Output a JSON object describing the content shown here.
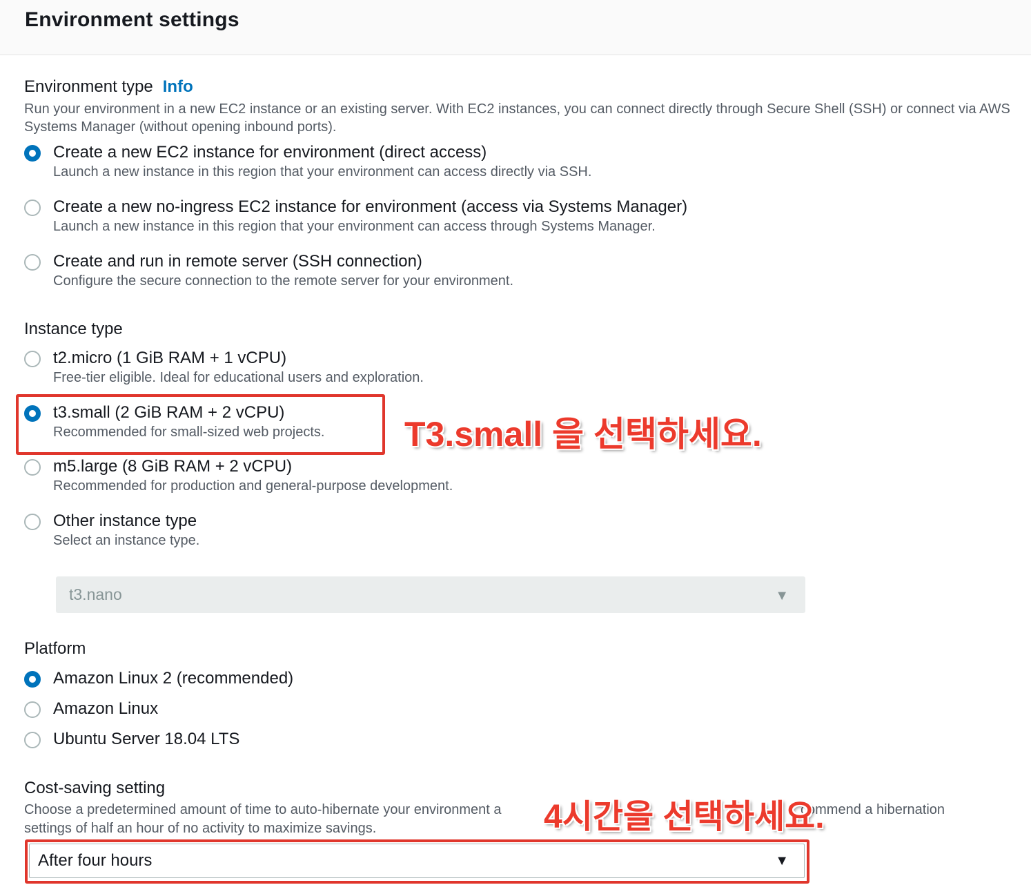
{
  "header": {
    "title": "Environment settings"
  },
  "environment_type": {
    "label": "Environment type",
    "info_link": "Info",
    "description": "Run your environment in a new EC2 instance or an existing server. With EC2 instances, you can connect directly through Secure Shell (SSH) or connect via AWS Systems Manager (without opening inbound ports).",
    "options": [
      {
        "label": "Create a new EC2 instance for environment (direct access)",
        "description": "Launch a new instance in this region that your environment can access directly via SSH.",
        "selected": true
      },
      {
        "label": "Create a new no-ingress EC2 instance for environment (access via Systems Manager)",
        "description": "Launch a new instance in this region that your environment can access through Systems Manager.",
        "selected": false
      },
      {
        "label": "Create and run in remote server (SSH connection)",
        "description": "Configure the secure connection to the remote server for your environment.",
        "selected": false
      }
    ]
  },
  "instance_type": {
    "label": "Instance type",
    "options": [
      {
        "label": "t2.micro (1 GiB RAM + 1 vCPU)",
        "description": "Free-tier eligible. Ideal for educational users and exploration.",
        "selected": false
      },
      {
        "label": "t3.small (2 GiB RAM + 2 vCPU)",
        "description": "Recommended for small-sized web projects.",
        "selected": true
      },
      {
        "label": "m5.large (8 GiB RAM + 2 vCPU)",
        "description": "Recommended for production and general-purpose development.",
        "selected": false
      },
      {
        "label": "Other instance type",
        "description": "Select an instance type.",
        "selected": false
      }
    ],
    "other_select_value": "t3.nano"
  },
  "platform": {
    "label": "Platform",
    "options": [
      {
        "label": "Amazon Linux 2 (recommended)",
        "selected": true
      },
      {
        "label": "Amazon Linux",
        "selected": false
      },
      {
        "label": "Ubuntu Server 18.04 LTS",
        "selected": false
      }
    ]
  },
  "cost_saving": {
    "label": "Cost-saving setting",
    "description_line1": "Choose a predetermined amount of time to auto-hibernate your environment a",
    "description_line1_tail": "commend a hibernation",
    "description_line2": "settings of half an hour of no activity to maximize savings.",
    "selected_value": "After four hours"
  },
  "annotations": {
    "instance_note": "T3.small 을 선택하세요.",
    "cost_note": "4시간을 선택하세요."
  },
  "colors": {
    "accent": "#0073bb",
    "annotation_red": "#e0362c"
  },
  "icons": {
    "select_caret": "▼"
  }
}
